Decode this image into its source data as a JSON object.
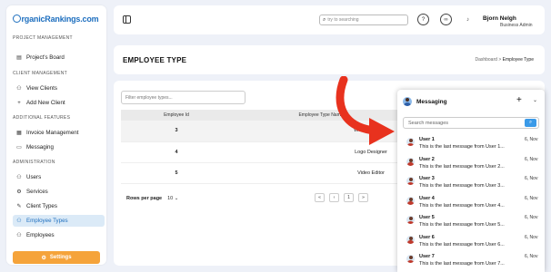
{
  "sidebar": {
    "logo": "rganicRankings.com",
    "sections": {
      "project": "PROJECT MANAGEMENT",
      "client": "CLIENT MANAGEMENT",
      "features": "ADDITIONAL FEATURES",
      "admin": "ADMINISTRATION"
    },
    "items": [
      {
        "label": "Project's Board",
        "icon": "clipboard-icon"
      },
      {
        "label": "View Clients",
        "icon": "user-icon"
      },
      {
        "label": "Add New Client",
        "icon": "user-plus-icon"
      },
      {
        "label": "Invoice Management",
        "icon": "invoice-icon"
      },
      {
        "label": "Messaging",
        "icon": "chat-icon"
      },
      {
        "label": "Users",
        "icon": "users-icon"
      },
      {
        "label": "Services",
        "icon": "services-icon"
      },
      {
        "label": "Client Types",
        "icon": "tag-icon"
      },
      {
        "label": "Employee Types",
        "icon": "employee-types-icon"
      },
      {
        "label": "Employees",
        "icon": "employees-icon"
      }
    ],
    "settings_label": "Settings"
  },
  "header": {
    "search_placeholder": "try to searching",
    "user_name": "Bjorn Nelgh",
    "user_role": "Business Admin"
  },
  "page": {
    "title": "EMPLOYEE TYPE",
    "breadcrumb_home": "Dashboard",
    "breadcrumb_sep": ">",
    "breadcrumb_current": "Employee Type"
  },
  "table": {
    "filter_placeholder": "Filter employee types...",
    "headers": [
      "Employee Id",
      "Employee Type Name"
    ],
    "rows": [
      {
        "id": "3",
        "name": "Web Developer"
      },
      {
        "id": "4",
        "name": "Logo Designer"
      },
      {
        "id": "5",
        "name": "Video Editor"
      }
    ],
    "rows_per_page_label": "Rows per page",
    "rows_per_page_value": "10",
    "current_page": "1"
  },
  "messaging": {
    "title": "Messaging",
    "search_placeholder": "Search messages",
    "items": [
      {
        "user": "User 1",
        "text": "This is the last message from User 1...",
        "date": "6, Nov"
      },
      {
        "user": "User 2",
        "text": "This is the last message from User 2...",
        "date": "6, Nov"
      },
      {
        "user": "User 3",
        "text": "This is the last message from User 3...",
        "date": "6, Nov"
      },
      {
        "user": "User 4",
        "text": "This is the last message from User 4...",
        "date": "6, Nov"
      },
      {
        "user": "User 5",
        "text": "This is the last message from User 5...",
        "date": "6, Nov"
      },
      {
        "user": "User 6",
        "text": "This is the last message from User 6...",
        "date": "6, Nov"
      },
      {
        "user": "User 7",
        "text": "This is the last message from User 7...",
        "date": "6, Nov"
      }
    ]
  },
  "colors": {
    "accent": "#1e6fbf",
    "settings": "#f5a33a",
    "arrow": "#e8321e"
  }
}
